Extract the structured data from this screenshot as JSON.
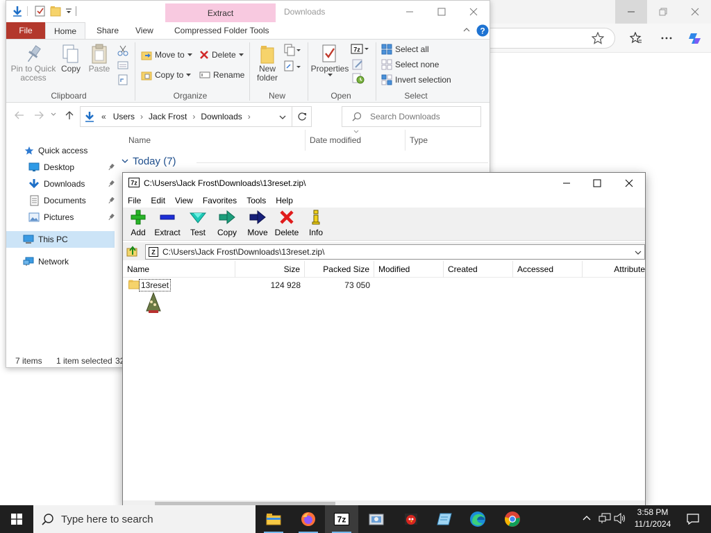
{
  "explorer": {
    "title": "Downloads",
    "extract_context": "Extract",
    "tabs": {
      "file": "File",
      "home": "Home",
      "share": "Share",
      "view": "View",
      "compressed": "Compressed Folder Tools"
    },
    "ribbon": {
      "pin": "Pin to Quick access",
      "copy": "Copy",
      "paste": "Paste",
      "clipboard": "Clipboard",
      "move_to": "Move to",
      "copy_to": "Copy to",
      "delete": "Delete",
      "rename": "Rename",
      "organize": "Organize",
      "new_folder": "New folder",
      "new": "New",
      "properties": "Properties",
      "open": "Open",
      "select_all": "Select all",
      "select_none": "Select none",
      "invert": "Invert selection",
      "select": "Select"
    },
    "breadcrumb": {
      "prefix": "«",
      "items": [
        "Users",
        "Jack Frost",
        "Downloads"
      ]
    },
    "search_placeholder": "Search Downloads",
    "columns": {
      "name": "Name",
      "date": "Date modified",
      "type": "Type"
    },
    "group": "Today (7)",
    "nav": {
      "quick_access": "Quick access",
      "desktop": "Desktop",
      "downloads": "Downloads",
      "documents": "Documents",
      "pictures": "Pictures",
      "this_pc": "This PC",
      "network": "Network"
    },
    "status": {
      "items": "7 items",
      "selected": "1 item selected",
      "size_partial": "32"
    }
  },
  "sevenzip": {
    "title": "C:\\Users\\Jack Frost\\Downloads\\13reset.zip\\",
    "menu": [
      "File",
      "Edit",
      "View",
      "Favorites",
      "Tools",
      "Help"
    ],
    "toolbar": {
      "add": "Add",
      "extract": "Extract",
      "test": "Test",
      "copy": "Copy",
      "move": "Move",
      "delete": "Delete",
      "info": "Info"
    },
    "path": "C:\\Users\\Jack Frost\\Downloads\\13reset.zip\\",
    "columns": {
      "name": "Name",
      "size": "Size",
      "packed": "Packed Size",
      "modified": "Modified",
      "created": "Created",
      "accessed": "Accessed",
      "attributes": "Attribute"
    },
    "rows": [
      {
        "name": "13reset",
        "size": "124 928",
        "packed": "73 050"
      }
    ]
  },
  "taskbar": {
    "search_placeholder": "Type here to search",
    "time": "3:58 PM",
    "date": "11/1/2024"
  },
  "colors": {
    "file_tab": "#b3382c",
    "extract_ctx": "#f8c9e0",
    "accent": "#0078d7",
    "taskbar": "#1f1f1f"
  }
}
